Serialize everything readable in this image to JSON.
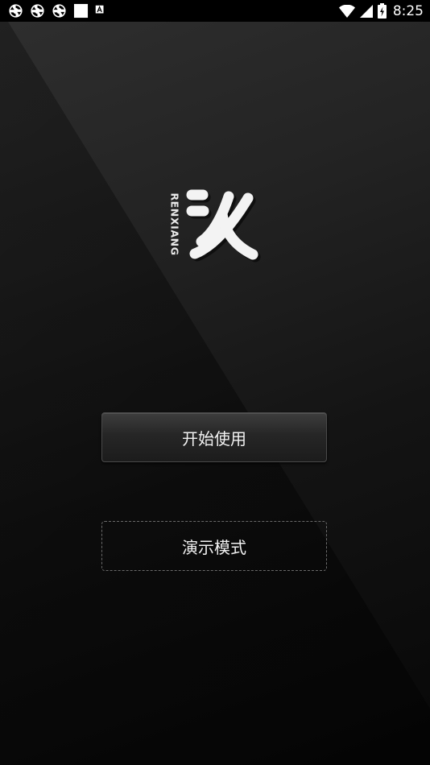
{
  "status_bar": {
    "time": "8:25",
    "left_icons": [
      "sync-icon",
      "sync-icon",
      "sync-icon",
      "blank-notification-icon",
      "a-notification-icon"
    ],
    "right_icons": [
      "wifi-icon",
      "signal-icon",
      "battery-charging-icon"
    ]
  },
  "logo": {
    "text": "RENXIANG",
    "icon": "renxiang-logo-icon"
  },
  "buttons": {
    "start_label": "开始使用",
    "demo_label": "演示模式"
  },
  "colors": {
    "background_top": "#2f2f2f",
    "background_bottom": "#070707",
    "text": "#f2f2f2"
  }
}
